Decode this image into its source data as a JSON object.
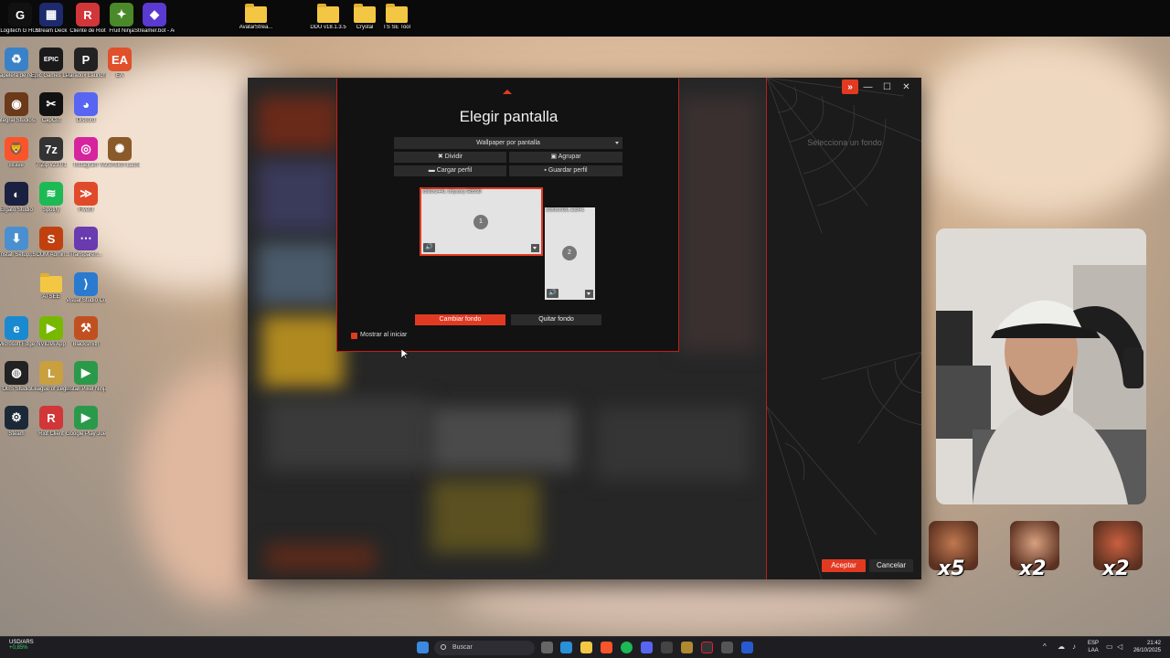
{
  "desktop": {
    "top_icons": [
      {
        "label": "Logitech G HUB",
        "glyph": "G",
        "color": "#111111"
      },
      {
        "label": "Stream Deck",
        "glyph": "▦",
        "color": "#1e2a6e"
      },
      {
        "label": "Cliente de Riot",
        "glyph": "R",
        "color": "#d13639"
      },
      {
        "label": "Fruit Ninja",
        "glyph": "✦",
        "color": "#4a8a2a"
      },
      {
        "label": "Streamer.bot - Acceso di...",
        "glyph": "◆",
        "color": "#5a3ad0"
      },
      {
        "label": "AvatarStrea...",
        "glyph": "",
        "color": "#f3c744"
      },
      {
        "label": "DDU v18.1.3.5",
        "glyph": "",
        "color": "#f3c744"
      },
      {
        "label": "Crystal",
        "glyph": "",
        "color": "#f3c744"
      },
      {
        "label": "TS SE Tool",
        "glyph": "",
        "color": "#f3c744"
      }
    ],
    "left_icons": [
      {
        "label": "Papelera de reciclaje",
        "glyph": "♻",
        "color": "#3a82c8"
      },
      {
        "label": "Epic Games Launcher",
        "glyph": "EPIC",
        "color": "#1a1a1a"
      },
      {
        "label": "Paradox Launcher v2",
        "glyph": "P",
        "color": "#222222"
      },
      {
        "label": "EA",
        "glyph": "EA",
        "color": "#e0502a"
      },
      {
        "label": "Integral Studios...",
        "glyph": "◉",
        "color": "#6a3a1a"
      },
      {
        "label": "CapCut",
        "glyph": "✂",
        "color": "#111111"
      },
      {
        "label": "Discord",
        "glyph": "◕",
        "color": "#5865f2"
      },
      {
        "label": "Brave",
        "glyph": "🦁",
        "color": "#fb542b"
      },
      {
        "label": "7-Zip v23.01",
        "glyph": "7z",
        "color": "#333333"
      },
      {
        "label": "Instagram",
        "glyph": "◎",
        "color": "#d6249f"
      },
      {
        "label": "Ascension Launcher",
        "glyph": "✺",
        "color": "#8a5a2a"
      },
      {
        "label": "Elgato Studio",
        "glyph": "◐",
        "color": "#1a2040"
      },
      {
        "label": "Spotify",
        "glyph": "≋",
        "color": "#1db954"
      },
      {
        "label": "FiveM",
        "glyph": "≫",
        "color": "#e04a2a"
      },
      {
        "label": "Install Setup...",
        "glyph": "⬇",
        "color": "#4a90d0"
      },
      {
        "label": "SCUM Admin...",
        "glyph": "S",
        "color": "#c04010"
      },
      {
        "label": "Transparen...",
        "glyph": "⋯",
        "color": "#6a3ab0"
      },
      {
        "label": "ATSEE",
        "glyph": "",
        "color": "#f3c744"
      },
      {
        "label": "Visual Studio Code",
        "glyph": "⟩",
        "color": "#2a7ad0"
      },
      {
        "label": "Microsoft Edge",
        "glyph": "e",
        "color": "#1a8ad0"
      },
      {
        "label": "NVIDIA App",
        "glyph": "▶",
        "color": "#76b900"
      },
      {
        "label": "Blacksmith",
        "glyph": "⚒",
        "color": "#c05020"
      },
      {
        "label": "OBS Studio",
        "glyph": "◍",
        "color": "#222222"
      },
      {
        "label": "League of Legends",
        "glyph": "L",
        "color": "#c8a040"
      },
      {
        "label": "Install Pixel Ninja Games...",
        "glyph": "▶",
        "color": "#2a9a4a"
      },
      {
        "label": "Steam",
        "glyph": "⚙",
        "color": "#1b2838"
      },
      {
        "label": "Riot Client",
        "glyph": "R",
        "color": "#d13639"
      },
      {
        "label": "Google Play Juegos Beta",
        "glyph": "▶",
        "color": "#2a9a4a"
      }
    ]
  },
  "app": {
    "select_background_hint": "Selecciona un fondo",
    "accept_label": "Aceptar",
    "cancel_label": "Cancelar",
    "window_controls": {
      "expand": "»",
      "minimize": "—",
      "maximize": "☐",
      "close": "✕"
    }
  },
  "dialog": {
    "title": "Elegir pantalla",
    "mode_dropdown": "Wallpaper por pantalla",
    "split_label": "Dividir",
    "group_label": "Agrupar",
    "load_profile_label": "Cargar perfil",
    "save_profile_label": "Guardar perfil",
    "monitors": [
      {
        "label": "2560x1440, Odyssey G85SD",
        "number": "1",
        "selected": true
      },
      {
        "label": "1080x1920, E2341",
        "number": "2",
        "selected": false
      }
    ],
    "change_bg_label": "Cambiar fondo",
    "remove_bg_label": "Quitar fondo",
    "show_on_start_label": "Mostrar al iniciar",
    "show_on_start_checked": true
  },
  "overlay": {
    "emotes": [
      {
        "count": "x5"
      },
      {
        "count": "x2"
      },
      {
        "count": "x2"
      }
    ]
  },
  "taskbar": {
    "ticker_symbol": "USD/ARS",
    "ticker_change": "+0,85%",
    "search_placeholder": "Buscar",
    "lang_1": "ESP",
    "lang_2": "LAA",
    "time": "21:42",
    "date": "26/10/2025"
  }
}
